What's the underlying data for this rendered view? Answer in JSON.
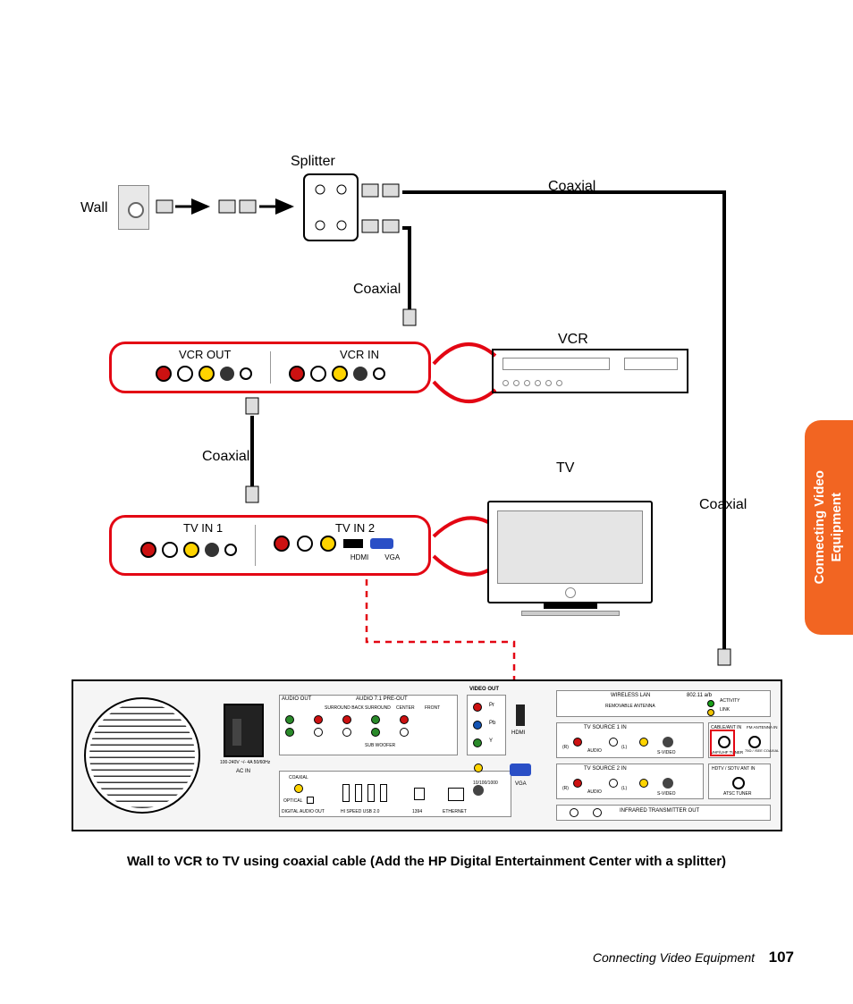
{
  "labels": {
    "wall": "Wall",
    "splitter": "Splitter",
    "coaxial_top": "Coaxial",
    "coaxial_mid": "Coaxial",
    "coaxial_left": "Coaxial",
    "coaxial_right": "Coaxial",
    "vcr": "VCR",
    "tv": "TV"
  },
  "callout_vcr": {
    "out_title": "VCR OUT",
    "in_title": "VCR IN"
  },
  "callout_tv": {
    "in1_title": "TV IN 1",
    "in2_title": "TV IN 2",
    "hdmi": "HDMI",
    "vga": "VGA"
  },
  "chassis": {
    "ac_in": "AC IN",
    "ac_spec": "100-240V ~/- 4A 50/60Hz",
    "audio_out": "AUDIO OUT",
    "audio_pre": "AUDIO 7.1 PRE-OUT",
    "surround_back": "SURROUND BACK",
    "surround": "SURROUND",
    "center": "CENTER",
    "front": "FRONT",
    "sub": "SUB WOOFER",
    "coaxial": "COAXIAL",
    "optical": "OPTICAL",
    "digital": "DIGITAL AUDIO OUT",
    "usb": "HI SPEED USB 2.0",
    "fw": "1394",
    "ethernet": "ETHERNET",
    "eth_speed": "10/100/1000",
    "video_out": "VIDEO OUT",
    "pr": "Pr",
    "pb": "Pb",
    "y": "Y",
    "hdmi": "HDMI",
    "vga": "VGA",
    "wlan": "WIRELESS LAN",
    "wlan_std": "802.11 a/b",
    "rem_ant": "REMOVABLE ANTENNA",
    "activity": "ACTIVITY",
    "link": "LINK",
    "tv_src1": "TV SOURCE   1   IN",
    "tv_src2": "TV SOURCE   2   IN",
    "audio_l": "AUDIO",
    "audio_r": "(R)",
    "audio_l2": "(L)",
    "svideo": "S-VIDEO",
    "cable_ant_in": "CABLE/ANT IN",
    "fm_ant": "FM ANTENNA IN",
    "fm_split": "75Ω /    /SEE COAXIAL",
    "vhf_tuner": "VHF/UHF TUNER",
    "hdtv_ant": "HDTV / SDTV ANT IN",
    "atsc": "ATSC TUNER",
    "ir_out": "INFRARED TRANSMITTER OUT"
  },
  "caption": "Wall to VCR to TV using coaxial cable (Add the HP Digital Entertainment Center with a splitter)",
  "footer": {
    "section": "Connecting Video Equipment",
    "page": "107"
  },
  "side_tab": "Connecting Video\nEquipment"
}
